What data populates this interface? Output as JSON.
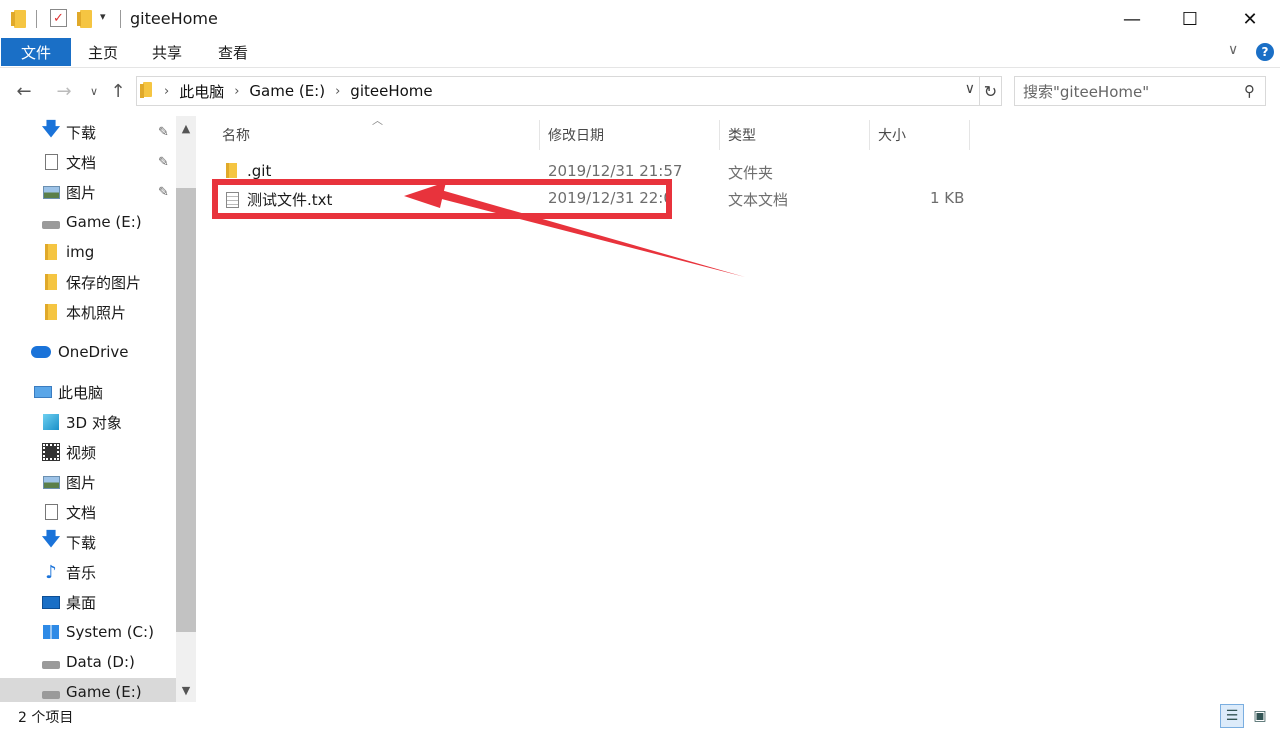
{
  "window": {
    "title": "giteeHome",
    "minimize_glyph": "—",
    "maximize_glyph": "☐",
    "close_glyph": "✕"
  },
  "ribbon": {
    "tabs": [
      {
        "label": "文件"
      },
      {
        "label": "主页"
      },
      {
        "label": "共享"
      },
      {
        "label": "查看"
      }
    ],
    "expand_glyph": "∨",
    "help_glyph": "?"
  },
  "address": {
    "crumbs": [
      "此电脑",
      "Game (E:)",
      "giteeHome"
    ],
    "separator": "›",
    "search_placeholder": "搜索\"giteeHome\""
  },
  "nav": {
    "items": [
      {
        "label": "下载",
        "icon": "download-icon",
        "pinned": true
      },
      {
        "label": "文档",
        "icon": "document-icon",
        "pinned": true
      },
      {
        "label": "图片",
        "icon": "picture-icon",
        "pinned": true
      },
      {
        "label": "Game (E:)",
        "icon": "drive-icon"
      },
      {
        "label": "img",
        "icon": "folder-icon"
      },
      {
        "label": "保存的图片",
        "icon": "folder-icon"
      },
      {
        "label": "本机照片",
        "icon": "folder-icon"
      },
      {
        "label": "OneDrive",
        "icon": "onedrive-icon"
      },
      {
        "label": "此电脑",
        "icon": "this-pc-icon"
      },
      {
        "label": "3D 对象",
        "icon": "3d-objects-icon"
      },
      {
        "label": "视频",
        "icon": "video-icon"
      },
      {
        "label": "图片",
        "icon": "picture-icon"
      },
      {
        "label": "文档",
        "icon": "document-icon"
      },
      {
        "label": "下载",
        "icon": "download-icon"
      },
      {
        "label": "音乐",
        "icon": "music-icon"
      },
      {
        "label": "桌面",
        "icon": "desktop-icon"
      },
      {
        "label": "System (C:)",
        "icon": "windows-drive-icon"
      },
      {
        "label": "Data (D:)",
        "icon": "drive-icon"
      },
      {
        "label": "Game (E:)",
        "icon": "drive-icon",
        "selected": true
      }
    ]
  },
  "columns": {
    "name": "名称",
    "date": "修改日期",
    "type": "类型",
    "size": "大小"
  },
  "files": [
    {
      "name": ".git",
      "date": "2019/12/31 21:57",
      "type": "文件夹",
      "size": "",
      "icon": "folder-icon"
    },
    {
      "name": "测试文件.txt",
      "date": "2019/12/31 22:0",
      "type": "文本文档",
      "size": "1 KB",
      "icon": "text-file-icon"
    }
  ],
  "status": {
    "item_count": "2 个项目"
  },
  "colors": {
    "accent": "#1a6fc6",
    "annotation": "#e8333c"
  }
}
